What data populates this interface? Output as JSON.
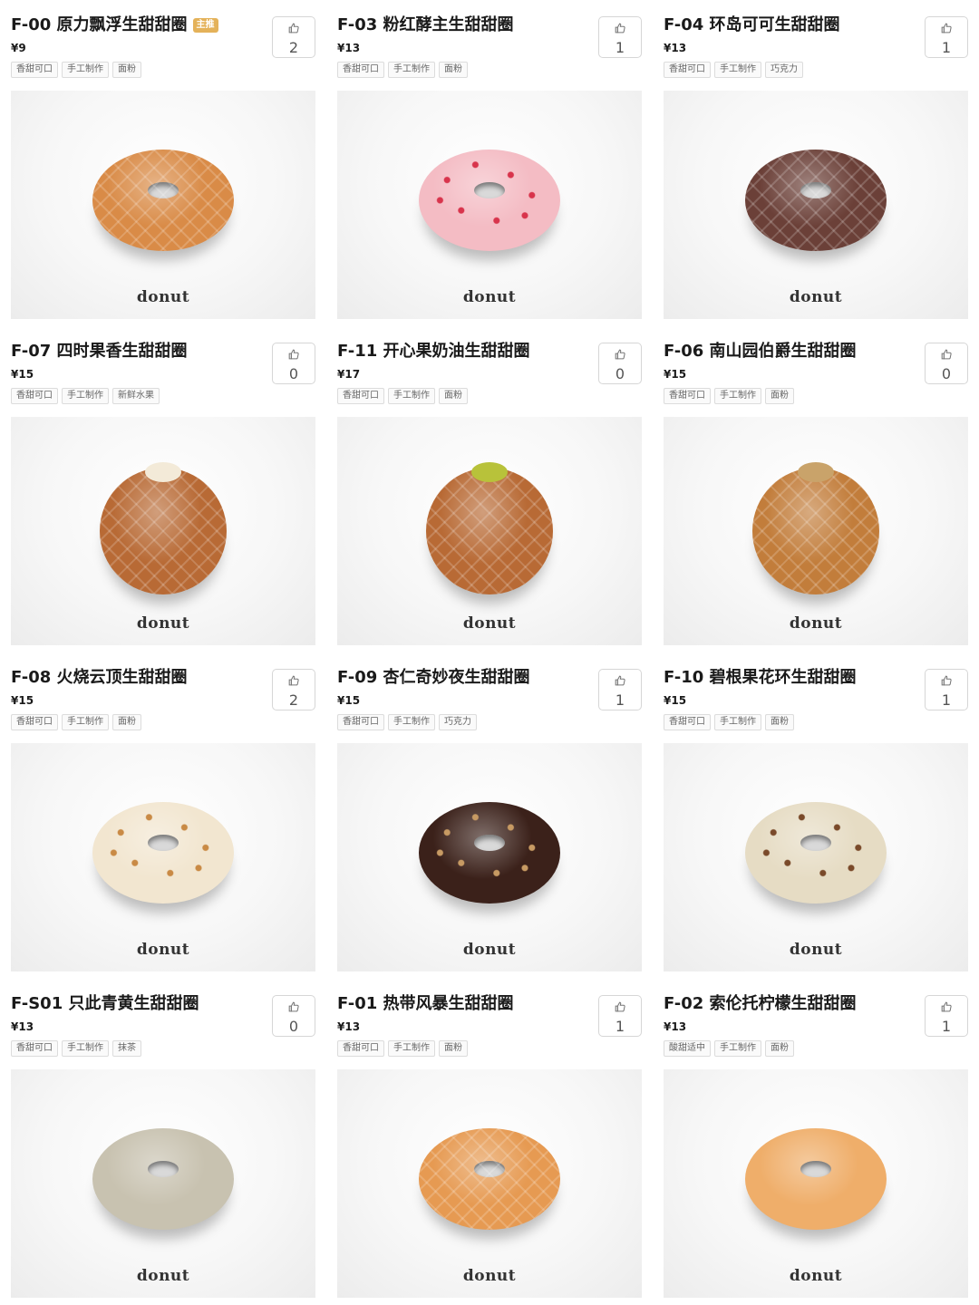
{
  "cards": [
    {
      "title": "F-00 原力飘浮生甜甜圈",
      "badge": "主推",
      "price": "¥9",
      "tags": [
        "香甜可口",
        "手工制作",
        "面粉"
      ],
      "likes": "2",
      "brand": "donut",
      "color": "#d98b47",
      "shape": "ring",
      "topping": "lattice"
    },
    {
      "title": "F-03 粉红酵主生甜甜圈",
      "badge": "",
      "price": "¥13",
      "tags": [
        "香甜可口",
        "手工制作",
        "面粉"
      ],
      "likes": "1",
      "brand": "donut",
      "color": "#f4bcc4",
      "shape": "ring",
      "topping": "sprinkles",
      "sprinkle_color": "#d8344c"
    },
    {
      "title": "F-04 环岛可可生甜甜圈",
      "badge": "",
      "price": "¥13",
      "tags": [
        "香甜可口",
        "手工制作",
        "巧克力"
      ],
      "likes": "1",
      "brand": "donut",
      "color": "#6b4038",
      "shape": "ring",
      "topping": "lattice"
    },
    {
      "title": "F-07 四时果香生甜甜圈",
      "badge": "",
      "price": "¥15",
      "tags": [
        "香甜可口",
        "手工制作",
        "新鲜水果"
      ],
      "likes": "0",
      "brand": "donut",
      "color": "#b86a35",
      "shape": "ball",
      "cream": "#f3ead8"
    },
    {
      "title": "F-11 开心果奶油生甜甜圈",
      "badge": "",
      "price": "¥17",
      "tags": [
        "香甜可口",
        "手工制作",
        "面粉"
      ],
      "likes": "0",
      "brand": "donut",
      "color": "#b86a35",
      "shape": "ball",
      "cream": "#b8c23a"
    },
    {
      "title": "F-06 南山园伯爵生甜甜圈",
      "badge": "",
      "price": "¥15",
      "tags": [
        "香甜可口",
        "手工制作",
        "面粉"
      ],
      "likes": "0",
      "brand": "donut",
      "color": "#c27d3b",
      "shape": "ball",
      "cream": "#c9a36a"
    },
    {
      "title": "F-08 火烧云顶生甜甜圈",
      "badge": "",
      "price": "¥15",
      "tags": [
        "香甜可口",
        "手工制作",
        "面粉"
      ],
      "likes": "2",
      "brand": "donut",
      "color": "#f2e6d0",
      "shape": "ring",
      "topping": "sprinkles",
      "sprinkle_color": "#c98a45"
    },
    {
      "title": "F-09 杏仁奇妙夜生甜甜圈",
      "badge": "",
      "price": "¥15",
      "tags": [
        "香甜可口",
        "手工制作",
        "巧克力"
      ],
      "likes": "1",
      "brand": "donut",
      "color": "#3b211a",
      "shape": "ring",
      "topping": "sprinkles",
      "sprinkle_color": "#c79a63"
    },
    {
      "title": "F-10 碧根果花环生甜甜圈",
      "badge": "",
      "price": "¥15",
      "tags": [
        "香甜可口",
        "手工制作",
        "面粉"
      ],
      "likes": "1",
      "brand": "donut",
      "color": "#e6dcc4",
      "shape": "ring",
      "topping": "sprinkles",
      "sprinkle_color": "#7a4a2a"
    },
    {
      "title": "F-S01 只此青黄生甜甜圈",
      "badge": "",
      "price": "¥13",
      "tags": [
        "香甜可口",
        "手工制作",
        "抹茶"
      ],
      "likes": "0",
      "brand": "donut",
      "color": "#c8c2b0",
      "shape": "ring",
      "topping": "none"
    },
    {
      "title": "F-01 热带风暴生甜甜圈",
      "badge": "",
      "price": "¥13",
      "tags": [
        "香甜可口",
        "手工制作",
        "面粉"
      ],
      "likes": "1",
      "brand": "donut",
      "color": "#e69a52",
      "shape": "ring",
      "topping": "lattice"
    },
    {
      "title": "F-02 索伦托柠檬生甜甜圈",
      "badge": "",
      "price": "¥13",
      "tags": [
        "酸甜适中",
        "手工制作",
        "面粉"
      ],
      "likes": "1",
      "brand": "donut",
      "color": "#efae6a",
      "shape": "ring",
      "topping": "none"
    }
  ]
}
